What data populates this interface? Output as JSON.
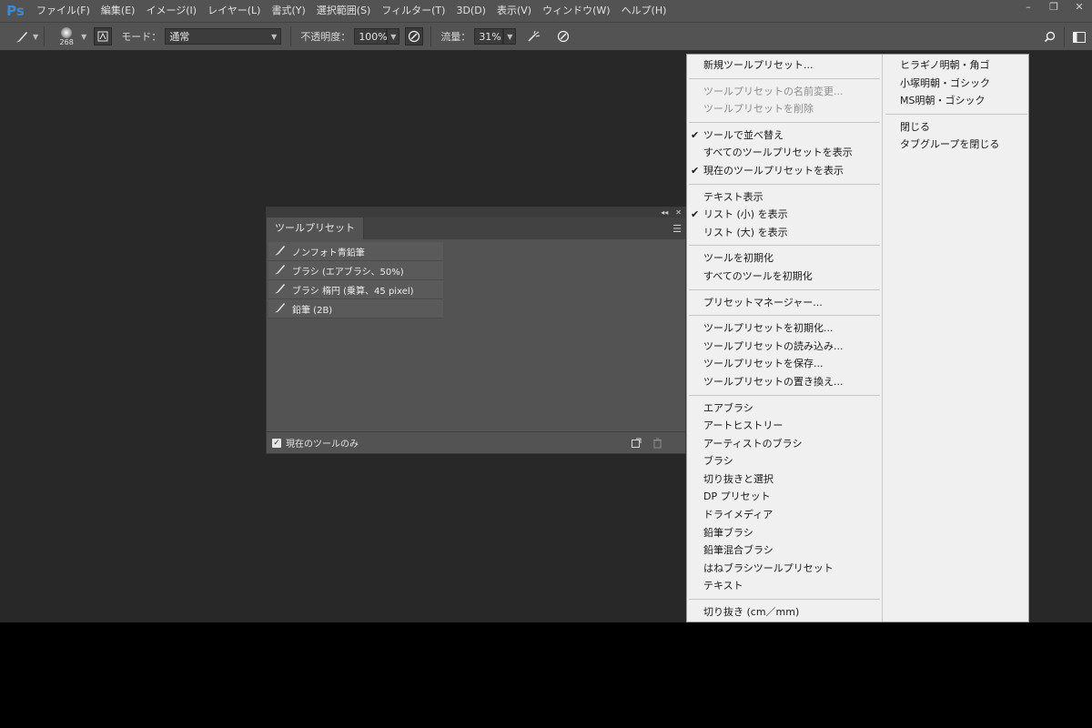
{
  "app": {
    "logo": "Ps"
  },
  "menubar": {
    "items": [
      "ファイル(F)",
      "編集(E)",
      "イメージ(I)",
      "レイヤー(L)",
      "書式(Y)",
      "選択範囲(S)",
      "フィルター(T)",
      "3D(D)",
      "表示(V)",
      "ウィンドウ(W)",
      "ヘルプ(H)"
    ]
  },
  "window_controls": [
    "minimize-icon",
    "restore-icon",
    "close-icon"
  ],
  "options": {
    "brush_size": "268",
    "mode_label": "モード：",
    "mode_value": "通常",
    "opacity_label": "不透明度：",
    "opacity_value": "100%",
    "flow_label": "流量：",
    "flow_value": "31%"
  },
  "panel": {
    "tab_label": "ツールプリセット",
    "presets": [
      "ノンフォト青鉛筆",
      "ブラシ (エアブラシ、50%)",
      "ブラシ 楕円 (乗算、45 pixel)",
      "鉛筆 (2B)"
    ],
    "footer_checkbox_label": "現在のツールのみ",
    "footer_checked": true
  },
  "dropdown": {
    "left": [
      {
        "label": "新規ツールプリセット...",
        "state": "normal"
      },
      {
        "sep": true
      },
      {
        "label": "ツールプリセットの名前変更...",
        "state": "disabled"
      },
      {
        "label": "ツールプリセットを削除",
        "state": "disabled"
      },
      {
        "sep": true
      },
      {
        "label": "ツールで並べ替え",
        "state": "checked"
      },
      {
        "label": "すべてのツールプリセットを表示",
        "state": "normal"
      },
      {
        "label": "現在のツールプリセットを表示",
        "state": "checked"
      },
      {
        "sep": true
      },
      {
        "label": "テキスト表示",
        "state": "normal"
      },
      {
        "label": "リスト (小) を表示",
        "state": "checked"
      },
      {
        "label": "リスト (大) を表示",
        "state": "normal"
      },
      {
        "sep": true
      },
      {
        "label": "ツールを初期化",
        "state": "normal"
      },
      {
        "label": "すべてのツールを初期化",
        "state": "normal"
      },
      {
        "sep": true
      },
      {
        "label": "プリセットマネージャー...",
        "state": "normal"
      },
      {
        "sep": true
      },
      {
        "label": "ツールプリセットを初期化...",
        "state": "normal"
      },
      {
        "label": "ツールプリセットの読み込み...",
        "state": "normal"
      },
      {
        "label": "ツールプリセットを保存...",
        "state": "normal"
      },
      {
        "label": "ツールプリセットの置き換え...",
        "state": "normal"
      },
      {
        "sep": true
      },
      {
        "label": "エアブラシ",
        "state": "normal"
      },
      {
        "label": "アートヒストリー",
        "state": "normal"
      },
      {
        "label": "アーティストのブラシ",
        "state": "normal"
      },
      {
        "label": "ブラシ",
        "state": "normal"
      },
      {
        "label": "切り抜きと選択",
        "state": "normal"
      },
      {
        "label": "DP プリセット",
        "state": "normal"
      },
      {
        "label": "ドライメディア",
        "state": "normal"
      },
      {
        "label": "鉛筆ブラシ",
        "state": "normal"
      },
      {
        "label": "鉛筆混合ブラシ",
        "state": "normal"
      },
      {
        "label": "はねブラシツールプリセット",
        "state": "normal"
      },
      {
        "label": "テキスト",
        "state": "normal"
      },
      {
        "sep": true
      },
      {
        "label": "切り抜き (cm／mm)",
        "state": "normal"
      }
    ],
    "right": [
      {
        "label": "ヒラギノ明朝・角ゴ",
        "state": "normal"
      },
      {
        "label": "小塚明朝・ゴシック",
        "state": "normal"
      },
      {
        "label": "MS明朝・ゴシック",
        "state": "normal"
      },
      {
        "sep": true
      },
      {
        "label": "閉じる",
        "state": "normal"
      },
      {
        "label": "タブグループを閉じる",
        "state": "normal"
      }
    ]
  }
}
